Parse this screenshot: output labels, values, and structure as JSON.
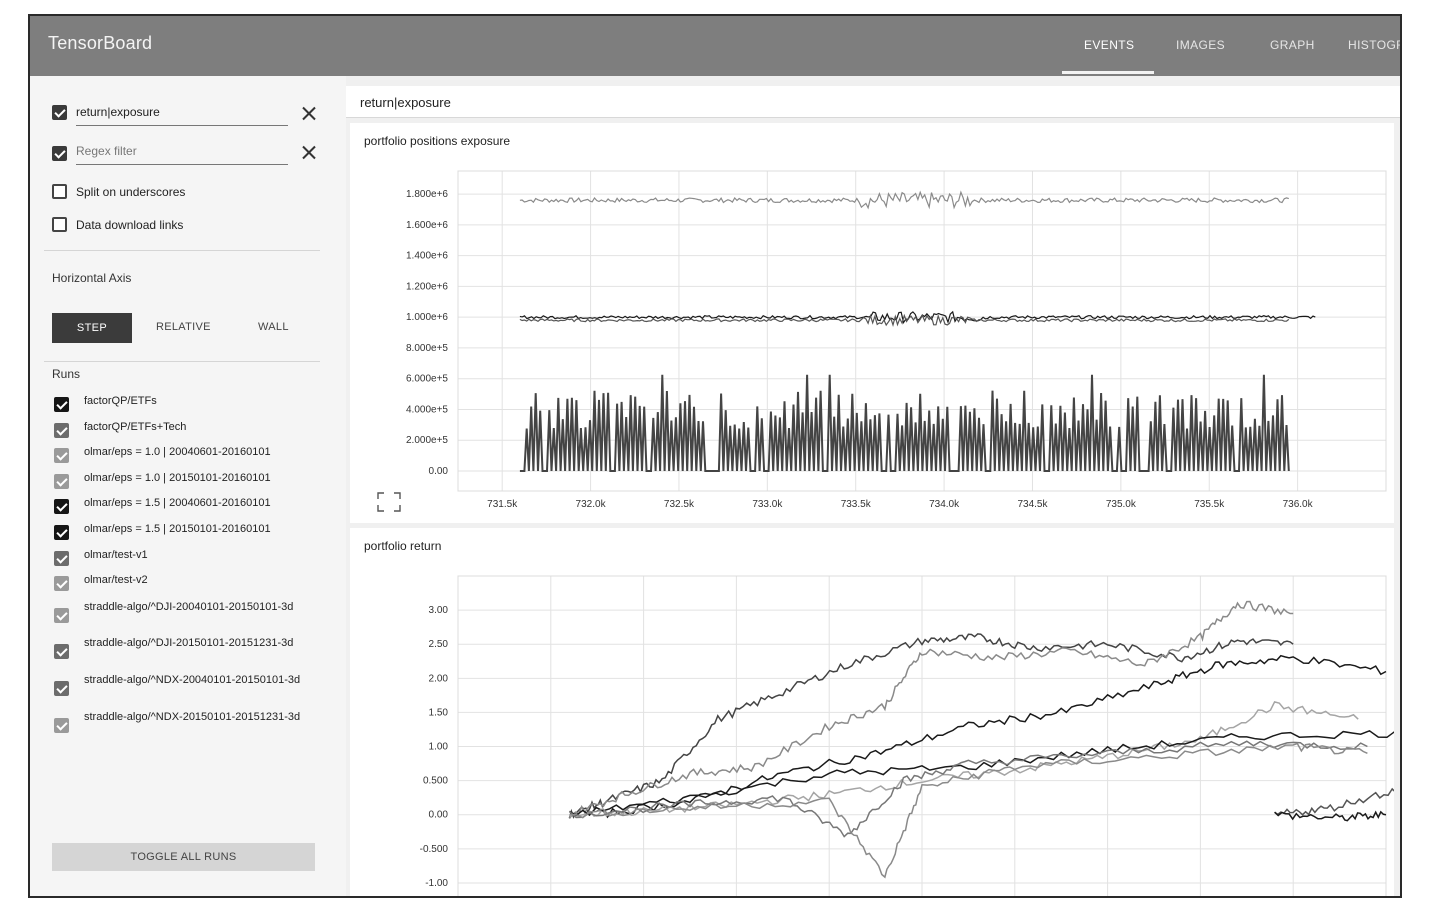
{
  "header": {
    "title": "TensorBoard",
    "tabs": [
      {
        "label": "EVENTS",
        "active": true
      },
      {
        "label": "IMAGES",
        "active": false
      },
      {
        "label": "GRAPH",
        "active": false
      },
      {
        "label": "HISTOGR",
        "active": false
      }
    ]
  },
  "sidebar": {
    "filters": [
      {
        "value": "return|exposure",
        "checked": true
      },
      {
        "placeholder": "Regex filter",
        "checked": true
      }
    ],
    "options": [
      {
        "label": "Split on underscores",
        "checked": false
      },
      {
        "label": "Data download links",
        "checked": false
      }
    ],
    "horizontal_axis": {
      "title": "Horizontal Axis",
      "options": [
        "STEP",
        "RELATIVE",
        "WALL"
      ],
      "selected": "STEP"
    },
    "runs": {
      "title": "Runs",
      "items": [
        {
          "label": "factorQP/ETFs",
          "color": "#1a1a1a"
        },
        {
          "label": "factorQP/ETFs+Tech",
          "color": "#555555"
        },
        {
          "label": "olmar/eps = 1.0 | 20040601-20160101",
          "color": "#8a8a8a"
        },
        {
          "label": "olmar/eps = 1.0 | 20150101-20160101",
          "color": "#8a8a8a"
        },
        {
          "label": "olmar/eps = 1.5 | 20040601-20160101",
          "color": "#1a1a1a"
        },
        {
          "label": "olmar/eps = 1.5 | 20150101-20160101",
          "color": "#1a1a1a"
        },
        {
          "label": "olmar/test-v1",
          "color": "#777777"
        },
        {
          "label": "olmar/test-v2",
          "color": "#a5a5a5"
        },
        {
          "label": "straddle-algo/^DJI-20040101-20150101-3d",
          "color": "#8a8a8a"
        },
        {
          "label": "straddle-algo/^DJI-20150101-20151231-3d",
          "color": "#555555"
        },
        {
          "label": "straddle-algo/^NDX-20040101-20150101-3d",
          "color": "#555555"
        },
        {
          "label": "straddle-algo/^NDX-20150101-20151231-3d",
          "color": "#8a8a8a"
        }
      ]
    },
    "toggle_label": "TOGGLE ALL RUNS"
  },
  "main": {
    "tag_group": "return|exposure"
  },
  "chart_data": [
    {
      "type": "line",
      "title": "portfolio positions exposure",
      "xlabel": "",
      "ylabel": "",
      "xlim": [
        731250,
        736500
      ],
      "ylim": [
        -130000,
        1950000
      ],
      "x_ticks": [
        731500,
        732000,
        732500,
        733000,
        733500,
        734000,
        734500,
        735000,
        735500,
        736000
      ],
      "x_tick_labels": [
        "731.5k",
        "732.0k",
        "732.5k",
        "733.0k",
        "733.5k",
        "734.0k",
        "734.5k",
        "735.0k",
        "735.5k",
        "736.0k"
      ],
      "y_ticks": [
        0,
        200000,
        400000,
        600000,
        800000,
        1000000,
        1200000,
        1400000,
        1600000,
        1800000
      ],
      "y_tick_labels": [
        "0.00",
        "2.000e+5",
        "4.000e+5",
        "6.000e+5",
        "8.000e+5",
        "1.000e+6",
        "1.200e+6",
        "1.400e+6",
        "1.600e+6",
        "1.800e+6"
      ],
      "grid": true,
      "series": [
        {
          "color": "#8a8a8a",
          "x_range": [
            731600,
            735950
          ],
          "center": 1760000,
          "noise": 15000
        },
        {
          "color": "#1a1a1a",
          "x_range": [
            731600,
            736100
          ],
          "center": 1000000,
          "noise": 10000
        },
        {
          "color": "#555555",
          "x_range": [
            731600,
            735950
          ],
          "center": 980000,
          "noise": 9000
        },
        {
          "color": "#444444",
          "x_range": [
            731600,
            735950
          ],
          "base": 0,
          "spike_height": 500000,
          "spiky": true
        }
      ]
    },
    {
      "type": "line",
      "title": "portfolio return",
      "xlabel": "",
      "ylabel": "",
      "xlim": [
        0,
        1
      ],
      "ylim": [
        -1.25,
        3.5
      ],
      "y_ticks": [
        -1.0,
        -0.5,
        0,
        0.5,
        1.0,
        1.5,
        2.0,
        2.5,
        3.0
      ],
      "y_tick_labels": [
        "-1.00",
        "-0.500",
        "0.00",
        "0.500",
        "1.00",
        "1.50",
        "2.00",
        "2.50",
        "3.00"
      ],
      "grid": true,
      "series": [
        {
          "color": "#444444",
          "x": [
            0.12,
            0.16,
            0.22,
            0.28,
            0.35,
            0.42,
            0.5,
            0.56,
            0.62,
            0.7,
            0.78,
            0.84,
            0.9
          ],
          "y": [
            0.0,
            0.2,
            0.5,
            1.4,
            1.8,
            2.2,
            2.55,
            2.6,
            2.45,
            2.5,
            2.3,
            2.55,
            2.5
          ]
        },
        {
          "color": "#8a8a8a",
          "x": [
            0.12,
            0.18,
            0.25,
            0.32,
            0.4,
            0.46,
            0.5,
            0.58,
            0.66,
            0.74,
            0.8,
            0.84,
            0.9
          ],
          "y": [
            0.0,
            0.3,
            0.6,
            0.7,
            1.3,
            1.6,
            2.4,
            2.3,
            2.4,
            2.2,
            2.6,
            3.1,
            2.95
          ]
        },
        {
          "color": "#1a1a1a",
          "x": [
            0.15,
            0.25,
            0.35,
            0.45,
            0.55,
            0.65,
            0.75,
            0.82,
            0.9,
            1.0
          ],
          "y": [
            0.0,
            0.2,
            0.6,
            0.9,
            1.3,
            1.5,
            1.9,
            2.2,
            2.3,
            2.1
          ]
        },
        {
          "color": "#a5a5a5",
          "x": [
            0.12,
            0.2,
            0.3,
            0.4,
            0.5,
            0.6,
            0.7,
            0.8,
            0.88,
            0.97
          ],
          "y": [
            0.0,
            0.05,
            0.15,
            0.3,
            0.5,
            0.65,
            0.85,
            1.1,
            1.6,
            1.4
          ]
        },
        {
          "color": "#1a1a1a",
          "x": [
            0.12,
            0.25,
            0.4,
            0.55,
            0.7,
            0.85,
            1.02
          ],
          "y": [
            0.0,
            0.25,
            0.6,
            0.7,
            0.95,
            1.15,
            1.2
          ]
        },
        {
          "color": "#777777",
          "x": [
            0.12,
            0.25,
            0.35,
            0.42,
            0.48,
            0.55,
            0.7,
            0.85,
            0.98
          ],
          "y": [
            0.0,
            0.15,
            0.25,
            -0.3,
            0.5,
            0.75,
            0.9,
            1.05,
            1.0
          ]
        },
        {
          "color": "#8a8a8a",
          "x": [
            0.12,
            0.25,
            0.4,
            0.46,
            0.5,
            0.6,
            0.75,
            0.9,
            0.98
          ],
          "y": [
            0.0,
            0.1,
            0.2,
            -0.9,
            0.4,
            0.7,
            0.85,
            1.0,
            0.9
          ]
        },
        {
          "color": "#555555",
          "x": [
            0.88,
            0.94,
            1.02
          ],
          "y": [
            0.0,
            0.1,
            0.4
          ]
        },
        {
          "color": "#1a1a1a",
          "x": [
            0.88,
            0.95,
            1.0
          ],
          "y": [
            0.0,
            -0.05,
            0.0
          ]
        }
      ]
    }
  ]
}
